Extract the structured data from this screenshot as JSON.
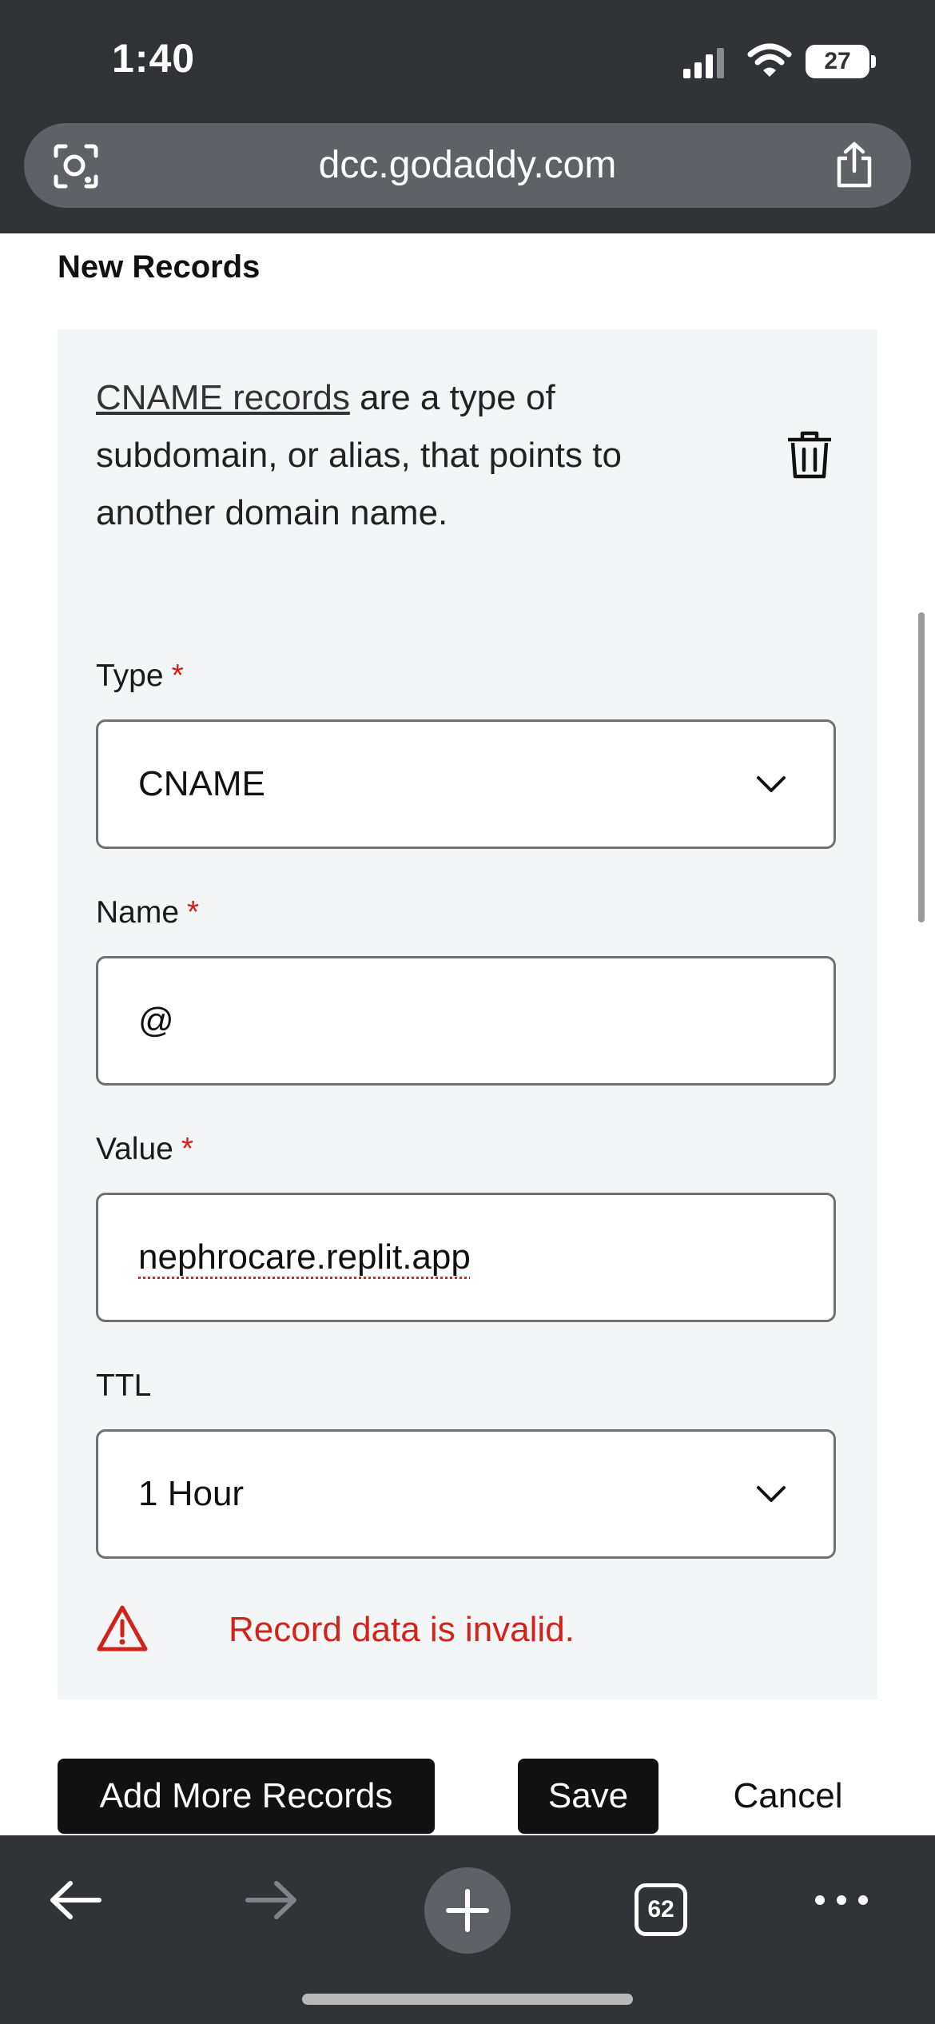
{
  "status_bar": {
    "time": "1:40",
    "battery": "27"
  },
  "browser": {
    "url": "dcc.godaddy.com",
    "open_tabs": "62"
  },
  "page": {
    "section_title": "New Records",
    "description_link": "CNAME records",
    "description_rest": " are a type of subdomain, or alias, that points to another domain name.",
    "fields": {
      "type": {
        "label": "Type",
        "required_mark": "*",
        "value": "CNAME"
      },
      "name": {
        "label": "Name",
        "required_mark": "*",
        "value": "@"
      },
      "value": {
        "label": "Value",
        "required_mark": "*",
        "value": "nephrocare.replit.app"
      },
      "ttl": {
        "label": "TTL",
        "value": "1 Hour"
      }
    },
    "error_message": "Record data is invalid.",
    "buttons": {
      "add_more": "Add More Records",
      "save": "Save",
      "cancel": "Cancel"
    }
  },
  "icons": {
    "camera": "camera-search-icon",
    "share": "share-icon",
    "trash": "trash-icon",
    "chevron": "chevron-down-icon",
    "warning": "warning-icon",
    "back": "back-arrow-icon",
    "forward": "forward-arrow-icon",
    "new_tab": "plus-icon",
    "more": "more-icon"
  },
  "colors": {
    "error": "#d0241a",
    "chrome": "#313336",
    "button": "#111111"
  }
}
